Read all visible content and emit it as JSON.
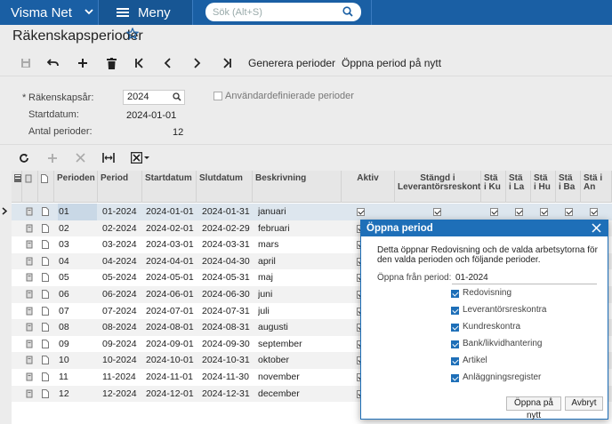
{
  "topbar": {
    "brand": "Visma Net",
    "menu_label": "Meny",
    "search_placeholder": "Sök (Alt+S)"
  },
  "page": {
    "title": "Räkenskapsperioder"
  },
  "toolbar": {
    "generate_label": "Generera perioder",
    "reopen_label": "Öppna period på nytt"
  },
  "form": {
    "fiscal_year_label": "Räkenskapsår:",
    "fiscal_year_value": "2024",
    "start_date_label": "Startdatum:",
    "start_date_value": "2024-01-01",
    "periods_count_label": "Antal perioder:",
    "periods_count_value": "12",
    "user_defined_label": "Användardefinierade perioder",
    "required_marker": "*"
  },
  "grid": {
    "headers": {
      "period": "Perioden",
      "period2": "Period",
      "start": "Startdatum",
      "end": "Slutdatum",
      "desc": "Beskrivning",
      "active": "Aktiv",
      "closed_ap": "Stängd i Leverantörsreskontra",
      "c1": "Stä i Ku",
      "c2": "Stä i La",
      "c3": "Stä i Hu",
      "c4": "Stä i Ba",
      "c5": "Stä i An"
    },
    "rows": [
      {
        "nr": "01",
        "period": "01-2024",
        "start": "2024-01-01",
        "end": "2024-01-31",
        "desc": "januari"
      },
      {
        "nr": "02",
        "period": "02-2024",
        "start": "2024-02-01",
        "end": "2024-02-29",
        "desc": "februari"
      },
      {
        "nr": "03",
        "period": "03-2024",
        "start": "2024-03-01",
        "end": "2024-03-31",
        "desc": "mars"
      },
      {
        "nr": "04",
        "period": "04-2024",
        "start": "2024-04-01",
        "end": "2024-04-30",
        "desc": "april"
      },
      {
        "nr": "05",
        "period": "05-2024",
        "start": "2024-05-01",
        "end": "2024-05-31",
        "desc": "maj"
      },
      {
        "nr": "06",
        "period": "06-2024",
        "start": "2024-06-01",
        "end": "2024-06-30",
        "desc": "juni"
      },
      {
        "nr": "07",
        "period": "07-2024",
        "start": "2024-07-01",
        "end": "2024-07-31",
        "desc": "juli"
      },
      {
        "nr": "08",
        "period": "08-2024",
        "start": "2024-08-01",
        "end": "2024-08-31",
        "desc": "augusti"
      },
      {
        "nr": "09",
        "period": "09-2024",
        "start": "2024-09-01",
        "end": "2024-09-30",
        "desc": "september"
      },
      {
        "nr": "10",
        "period": "10-2024",
        "start": "2024-10-01",
        "end": "2024-10-31",
        "desc": "oktober"
      },
      {
        "nr": "11",
        "period": "11-2024",
        "start": "2024-11-01",
        "end": "2024-11-30",
        "desc": "november"
      },
      {
        "nr": "12",
        "period": "12-2024",
        "start": "2024-12-01",
        "end": "2024-12-31",
        "desc": "december"
      }
    ]
  },
  "dialog": {
    "title": "Öppna period",
    "message": "Detta öppnar Redovisning och de valda arbetsytorna för den valda perioden och följande perioder.",
    "from_label": "Öppna från period:",
    "from_value": "01-2024",
    "options": [
      "Redovisning",
      "Leverantörsreskontra",
      "Kundreskontra",
      "Bank/likvidhantering",
      "Artikel",
      "Anläggningsregister"
    ],
    "confirm_label": "Öppna på nytt",
    "cancel_label": "Avbryt"
  },
  "colors": {
    "topbar": "#1a5fa4",
    "dialog_accent": "#1e6fb8",
    "selected_row": "#dde6ee"
  }
}
